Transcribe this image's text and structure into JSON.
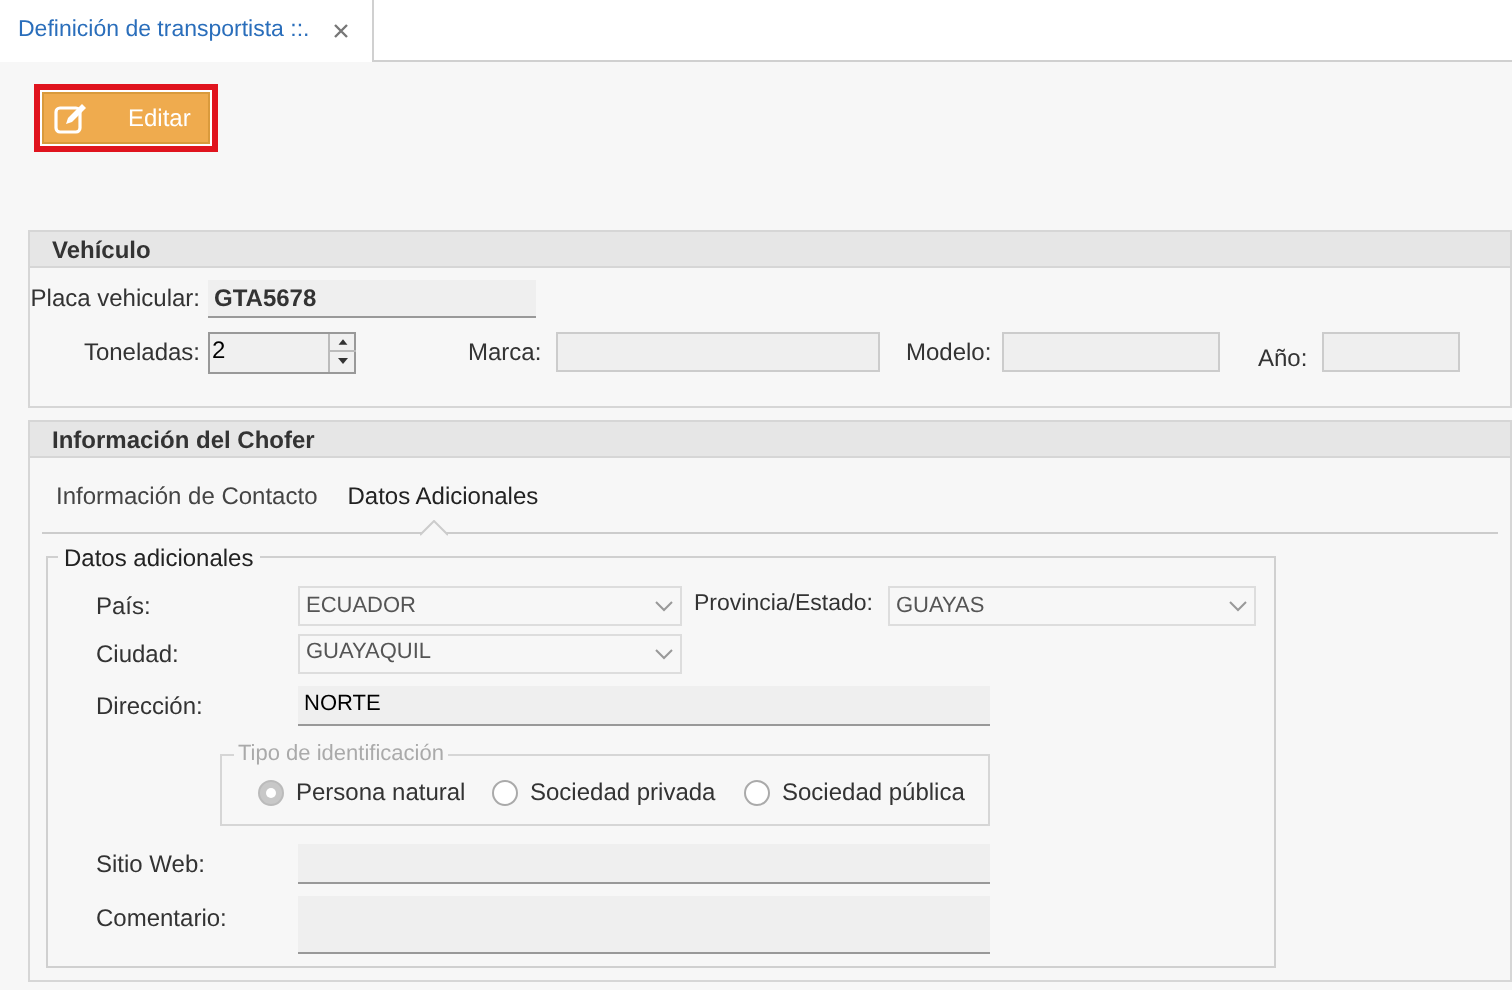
{
  "tabs": [
    {
      "label": "Definición de transportista ::.",
      "selected": true
    }
  ],
  "edit_button": {
    "label": "Editar"
  },
  "vehicle": {
    "title": "Vehículo",
    "plate": {
      "label": "Placa vehicular:",
      "value": "GTA5678"
    },
    "tons": {
      "label": "Toneladas:",
      "value": "2"
    },
    "brand": {
      "label": "Marca:"
    },
    "model": {
      "label": "Modelo:"
    },
    "year": {
      "label": "Año:"
    }
  },
  "driver": {
    "title": "Información del Chofer",
    "tabs": [
      {
        "label": "Información de Contacto",
        "selected": false
      },
      {
        "label": "Datos Adicionales",
        "selected": true
      }
    ],
    "group_title": "Datos adicionales",
    "country": {
      "label": "País:",
      "value": "ECUADOR"
    },
    "province": {
      "label": "Provincia/Estado:",
      "value": "GUAYAS"
    },
    "city": {
      "label": "Ciudad:",
      "value": "GUAYAQUIL"
    },
    "address": {
      "label": "Dirección:",
      "value": "NORTE"
    },
    "id_type": {
      "title": "Tipo de identificación",
      "options": [
        {
          "label": "Persona natural",
          "selected": true
        },
        {
          "label": "Sociedad privada",
          "selected": false
        },
        {
          "label": "Sociedad pública",
          "selected": false
        }
      ]
    },
    "website": {
      "label": "Sitio Web:"
    },
    "comment": {
      "label": "Comentario:"
    }
  }
}
